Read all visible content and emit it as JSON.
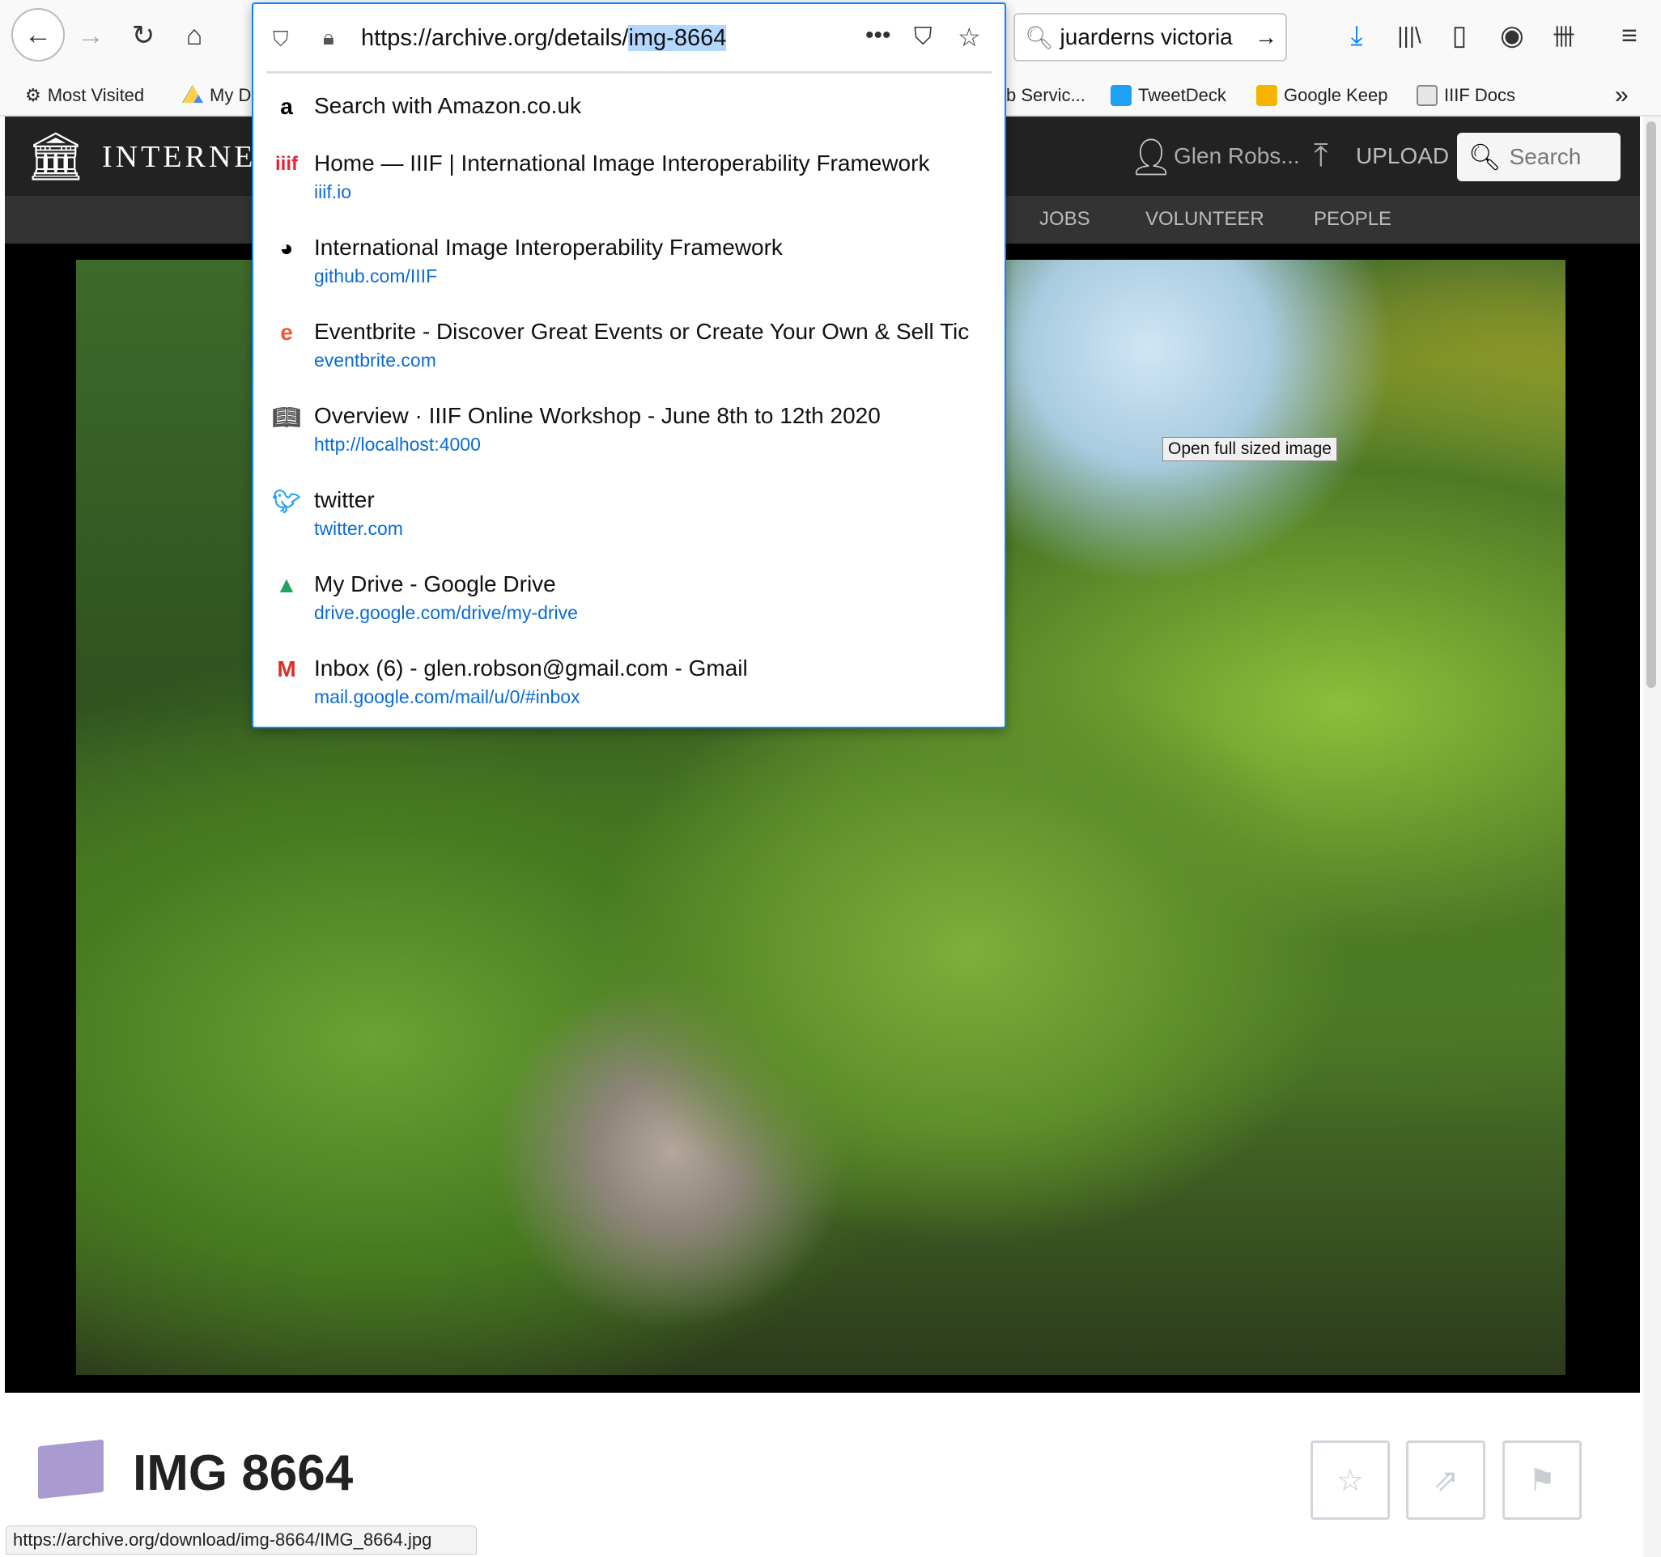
{
  "browser": {
    "url_prefix": "https://archive.org/details/",
    "url_selected": "img-8664",
    "search_value": "juarderns victoria",
    "bookmarks": [
      {
        "label": "Most Visited",
        "icon": "gear-icon"
      },
      {
        "label": "My D",
        "icon": "google-drive-icon"
      },
      {
        "label": "b Servic...",
        "icon": ""
      },
      {
        "label": "TweetDeck",
        "icon": "tweetdeck-icon"
      },
      {
        "label": "Google Keep",
        "icon": "google-keep-icon"
      },
      {
        "label": "IIIF Docs",
        "icon": "folder-icon"
      }
    ],
    "status_url": "https://archive.org/download/img-8664/IMG_8664.jpg",
    "accent": "#0a84ff"
  },
  "dropdown": {
    "search_suggestion": "Search with Amazon.co.uk",
    "items": [
      {
        "title": "Home — IIIF | International Image Interoperability Framework",
        "url": "iiif.io",
        "icon": "iiif-icon"
      },
      {
        "title": "International Image Interoperability Framework",
        "url": "github.com/IIIF",
        "icon": "github-icon"
      },
      {
        "title": "Eventbrite - Discover Great Events or Create Your Own & Sell Tic",
        "url": "eventbrite.com",
        "icon": "eventbrite-icon"
      },
      {
        "title": "Overview · IIIF Online Workshop - June 8th to 12th 2020",
        "url": "http://localhost:4000",
        "icon": "book-icon"
      },
      {
        "title": "twitter",
        "url": "twitter.com",
        "icon": "twitter-icon"
      },
      {
        "title": "My Drive - Google Drive",
        "url": "drive.google.com/drive/my-drive",
        "icon": "google-drive-icon"
      },
      {
        "title": "Inbox (6) - glen.robson@gmail.com - Gmail",
        "url": "mail.google.com/mail/u/0/#inbox",
        "icon": "gmail-icon"
      }
    ]
  },
  "site": {
    "logo_text": "INTERNET",
    "user": "Glen Robs...",
    "upload": "UPLOAD",
    "search": "Search",
    "nav": [
      "JOBS",
      "VOLUNTEER",
      "PEOPLE"
    ],
    "tooltip": "Open full sized image",
    "item_title": "IMG 8664"
  }
}
